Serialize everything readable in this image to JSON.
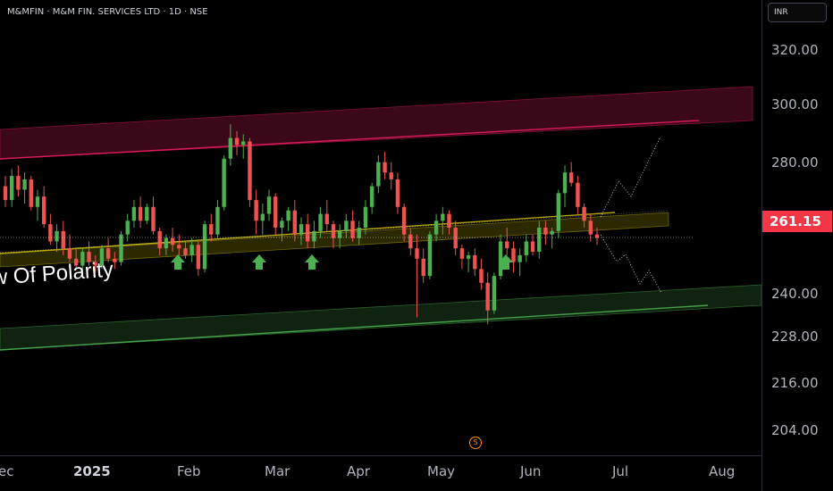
{
  "header": {
    "symbol_title": "M&MFIN · M&M FIN. SERVICES LTD · 1D · NSE"
  },
  "currency": {
    "label": "INR"
  },
  "annotation": {
    "text": "w Of Polarity"
  },
  "event_marker": {
    "label": "S"
  },
  "price_axis": {
    "ticks": [
      "320.00",
      "300.00",
      "280.00",
      "240.00",
      "228.00",
      "216.00",
      "204.00"
    ],
    "last_price": "261.15"
  },
  "time_axis": {
    "ticks": [
      {
        "label": "ec",
        "bold": false
      },
      {
        "label": "2025",
        "bold": true
      },
      {
        "label": "Feb",
        "bold": false
      },
      {
        "label": "Mar",
        "bold": false
      },
      {
        "label": "Apr",
        "bold": false
      },
      {
        "label": "May",
        "bold": false
      },
      {
        "label": "Jun",
        "bold": false
      },
      {
        "label": "Jul",
        "bold": false
      },
      {
        "label": "Aug",
        "bold": false
      }
    ]
  },
  "colors": {
    "background": "#000000",
    "up_candle": "#26a69a",
    "up_candle_alt": "#4caf50",
    "down_candle": "#ef5350",
    "resistance_zone": "#e91e63",
    "polarity_zone": "#c8b400",
    "support_zone": "#4caf50",
    "arrow": "#4caf50",
    "last_price_tag": "#f23645"
  },
  "chart_data": {
    "type": "candlestick",
    "symbol": "M&MFIN",
    "interval": "1D",
    "exchange": "NSE",
    "currency": "INR",
    "last_price": 261.15,
    "price_range": [
      198,
      330
    ],
    "candles_ohlc": [
      [
        276,
        279,
        270,
        272
      ],
      [
        272,
        281,
        270,
        279
      ],
      [
        279,
        282,
        273,
        275
      ],
      [
        275,
        280,
        271,
        278
      ],
      [
        278,
        279,
        269,
        270
      ],
      [
        270,
        275,
        266,
        273
      ],
      [
        273,
        276,
        264,
        265
      ],
      [
        265,
        268,
        259,
        260
      ],
      [
        260,
        265,
        257,
        263
      ],
      [
        263,
        266,
        256,
        258
      ],
      [
        258,
        262,
        254,
        255
      ],
      [
        255,
        258,
        252,
        253
      ],
      [
        253,
        258,
        251,
        257
      ],
      [
        257,
        260,
        253,
        254
      ],
      [
        254,
        256,
        251,
        253
      ],
      [
        253,
        259,
        252,
        258
      ],
      [
        258,
        261,
        254,
        255
      ],
      [
        255,
        257,
        252,
        254
      ],
      [
        254,
        263,
        253,
        262
      ],
      [
        262,
        268,
        260,
        266
      ],
      [
        266,
        272,
        264,
        270
      ],
      [
        270,
        273,
        264,
        266
      ],
      [
        266,
        271,
        265,
        270
      ],
      [
        270,
        273,
        262,
        263
      ],
      [
        263,
        264,
        256,
        258
      ],
      [
        258,
        262,
        256,
        261
      ],
      [
        261,
        264,
        257,
        259
      ],
      [
        259,
        262,
        256,
        258
      ],
      [
        258,
        260,
        255,
        256
      ],
      [
        256,
        261,
        254,
        259
      ],
      [
        259,
        260,
        250,
        252
      ],
      [
        252,
        266,
        251,
        265
      ],
      [
        265,
        268,
        260,
        262
      ],
      [
        262,
        272,
        261,
        270
      ],
      [
        270,
        285,
        269,
        284
      ],
      [
        284,
        294,
        282,
        290
      ],
      [
        290,
        292,
        285,
        288
      ],
      [
        288,
        291,
        284,
        289
      ],
      [
        289,
        290,
        270,
        272
      ],
      [
        272,
        275,
        262,
        266
      ],
      [
        266,
        271,
        262,
        268
      ],
      [
        268,
        275,
        266,
        273
      ],
      [
        273,
        274,
        262,
        264
      ],
      [
        264,
        267,
        260,
        266
      ],
      [
        266,
        270,
        263,
        269
      ],
      [
        269,
        272,
        260,
        262
      ],
      [
        262,
        267,
        259,
        265
      ],
      [
        265,
        268,
        258,
        260
      ],
      [
        260,
        266,
        258,
        263
      ],
      [
        263,
        270,
        261,
        268
      ],
      [
        268,
        272,
        263,
        265
      ],
      [
        265,
        266,
        258,
        261
      ],
      [
        261,
        265,
        258,
        263
      ],
      [
        263,
        268,
        261,
        266
      ],
      [
        266,
        269,
        260,
        261
      ],
      [
        261,
        266,
        259,
        264
      ],
      [
        264,
        272,
        262,
        270
      ],
      [
        270,
        277,
        268,
        276
      ],
      [
        276,
        285,
        274,
        283
      ],
      [
        283,
        286,
        278,
        280
      ],
      [
        280,
        283,
        275,
        278
      ],
      [
        278,
        280,
        268,
        270
      ],
      [
        270,
        271,
        260,
        262
      ],
      [
        262,
        264,
        256,
        258
      ],
      [
        258,
        262,
        238,
        255
      ],
      [
        255,
        258,
        248,
        250
      ],
      [
        250,
        263,
        249,
        262
      ],
      [
        262,
        268,
        260,
        266
      ],
      [
        266,
        270,
        262,
        268
      ],
      [
        268,
        269,
        262,
        264
      ],
      [
        264,
        266,
        256,
        258
      ],
      [
        258,
        259,
        252,
        255
      ],
      [
        255,
        257,
        251,
        256
      ],
      [
        256,
        258,
        250,
        252
      ],
      [
        252,
        255,
        246,
        248
      ],
      [
        248,
        251,
        236,
        240
      ],
      [
        240,
        251,
        239,
        250
      ],
      [
        250,
        262,
        249,
        260
      ],
      [
        260,
        264,
        256,
        258
      ],
      [
        258,
        260,
        251,
        254
      ],
      [
        254,
        258,
        250,
        256
      ],
      [
        256,
        262,
        254,
        260
      ],
      [
        260,
        262,
        256,
        257
      ],
      [
        257,
        266,
        255,
        264
      ],
      [
        264,
        266,
        259,
        262
      ],
      [
        262,
        264,
        258,
        263
      ],
      [
        263,
        275,
        261,
        274
      ],
      [
        274,
        282,
        270,
        280
      ],
      [
        280,
        283,
        276,
        277
      ],
      [
        277,
        279,
        268,
        270
      ],
      [
        270,
        271,
        264,
        266
      ],
      [
        266,
        268,
        260,
        262
      ],
      [
        262,
        264,
        259,
        261
      ]
    ],
    "zones": [
      {
        "name": "resistance",
        "from_date": "Dec 2024",
        "to_date": "Jul 2025",
        "low": 280,
        "high": 300
      },
      {
        "name": "polarity",
        "from_date": "Dec 2024",
        "to_date": "Jul 2025",
        "low": 248,
        "high": 264
      },
      {
        "name": "support",
        "from_date": "Dec 2024",
        "to_date": "Aug 2025",
        "low": 224,
        "high": 242
      }
    ],
    "markers": [
      "arrow-up",
      "arrow-up",
      "arrow-up",
      "arrow-up"
    ],
    "projections": [
      "up",
      "down"
    ]
  }
}
